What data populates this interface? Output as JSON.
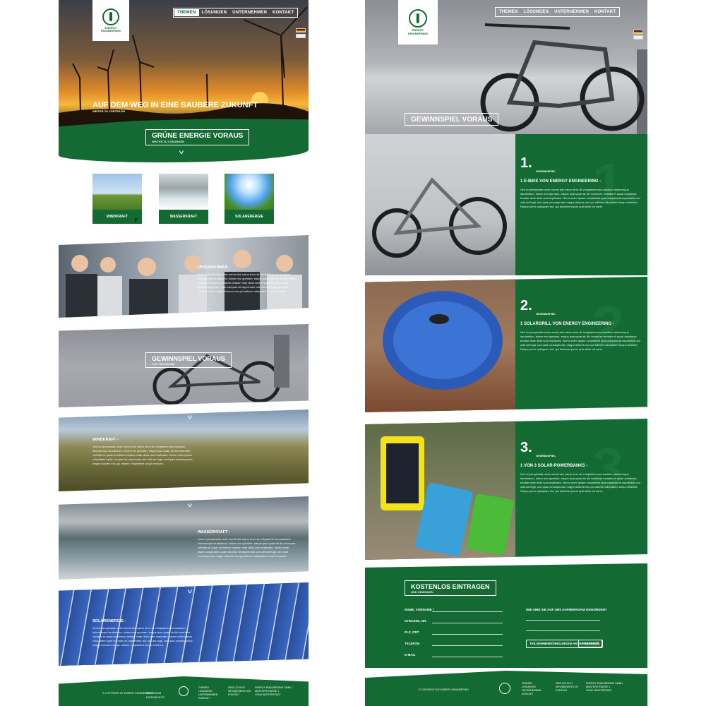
{
  "colors": {
    "brand_green": "#136b33",
    "white": "#ffffff"
  },
  "nav": {
    "items": [
      "THEMEN",
      "LÖSUNGEN",
      "UNTERNEHMEN",
      "KONTAKT"
    ],
    "active_left": "THEMEN"
  },
  "logo": {
    "name_line1": "ENERGY",
    "name_line2": "ENGINEERING"
  },
  "icons": {
    "logo": "plug-leaf-icon",
    "chevron": "chevron-down-icon",
    "flag_de": "flag-de-icon",
    "flag_en": "flag-en-icon",
    "cursor": "mouse-cursor-icon"
  },
  "left": {
    "hero_title": "AUF DEM WEG IN EINE SAUBERE ZUKUNFT",
    "hero_sub": "WEITER ZU VORTEILEN",
    "green_title": "GRÜNE ENERGIE VORAUS",
    "green_sub": "WEITER ZU LÖSUNGEN",
    "thumbs": [
      "WINDKRAFT",
      "WASSERKRAFT",
      "SOLARENERGIE"
    ],
    "company_title": "UNTERNEHMEN -",
    "contest_title": "GEWINNSPIEL VORAUS",
    "contest_sub": "ZUR TEILNAHME",
    "wind_title": "WINDKRAFT -",
    "water_title": "WASSERKRAFT -",
    "solar_title": "SOLARENERGIE -",
    "lorem": "Sed ut perspiciatis unde omnis iste natus error sit voluptatem accusantium doloremque laudantium, totam rem aperiam, eaque ipsa quae ab illo inventore veritatis et quasi architecto beatae vitae dicta sunt explicabo. Nemo enim ipsam voluptatem quia voluptas sit aspernatur aut odit aut fugit, sed quia consequuntur magni dolores eos qui ratione voluptatem sequi nesciunt."
  },
  "right": {
    "contest_title": "GEWINNSPIEL VORAUS",
    "steps": [
      {
        "num": "1.",
        "label": "GEWINNSPIEL",
        "title": "1 E-BIKE VON ENERGY ENGINEERING -"
      },
      {
        "num": "2.",
        "label": "GEWINNSPIEL",
        "title": "1 SOLARGRILL VON ENERGY ENGINEERING -"
      },
      {
        "num": "3.",
        "label": "GEWINNSPIEL",
        "title": "1 VON 3 SOLAR-POWERBANKS -"
      }
    ],
    "form_title": "KOSTENLOS EINTRAGEN",
    "form_sub": "UND GEWINNEN",
    "fields": [
      "NAME, VORNAME *",
      "STRASSE, NR.",
      "PLZ, ORT",
      "TELEFON",
      "E-MAIL"
    ],
    "question": "WIE SIND SIE AUF UNS AUFMERKSAM GEWORDEN?",
    "checkbox_label": "TEILNAHMEBEDINGUNGEN AKZEPTIEREN",
    "submit": "ABSENDEN",
    "lorem": "Sed ut perspiciatis unde omnis iste natus error sit voluptatem accusantium doloremque laudantium, totam rem aperiam, eaque ipsa quae ab illo inventore veritatis et quasi architecto beatae vitae dicta sunt explicabo. Nemo enim ipsam voluptatem quia voluptas sit aspernatur aut odit aut fugit, sed quia consequuntur magni dolores eos qui ratione voluptatem sequi nesciunt. Neque porro quisquam est, qui dolorem ipsum quia dolor sit amet."
  },
  "footer": {
    "copyright": "© COPYRIGHT BY ENERGY ENGINEERING",
    "links": [
      "IMPRESSUM",
      "DATENSCHUTZ"
    ],
    "nav": [
      "THEMEN",
      "LÖSUNGEN",
      "UNTERNEHMEN",
      "KONTAKT"
    ],
    "contact": [
      "0800 123 45 67",
      "INFO@ENERGY.DE",
      "KONTAKT"
    ],
    "address": [
      "ENERGY ENGINEERING GMBH",
      "MUSTERSTRASSE 1",
      "12345 MUSTERSTADT"
    ]
  }
}
